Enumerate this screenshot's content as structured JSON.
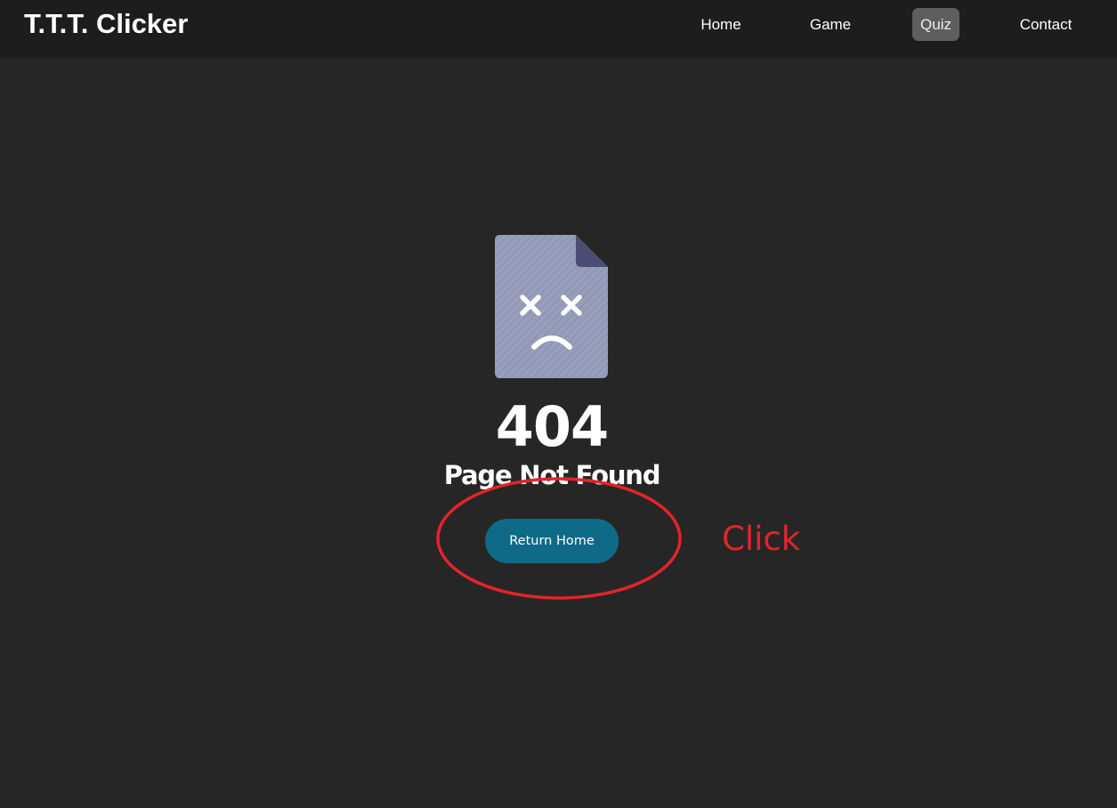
{
  "header": {
    "brand": "T.T.T. Clicker",
    "nav": [
      "Home",
      "Game",
      "Quiz",
      "Contact"
    ],
    "active_nav": "Quiz"
  },
  "error": {
    "icon": "sad-file-icon",
    "code": "404",
    "title": "Page Not Found",
    "button_label": "Return Home"
  },
  "annotation": {
    "text": "Click",
    "color": "#e3242b"
  },
  "colors": {
    "background": "#262626",
    "navbar": "#1d1d1d",
    "button": "#0e6a87",
    "active_nav": "#5e5e5e",
    "icon_body": "#979fbb",
    "icon_fold": "#4b4e74"
  }
}
